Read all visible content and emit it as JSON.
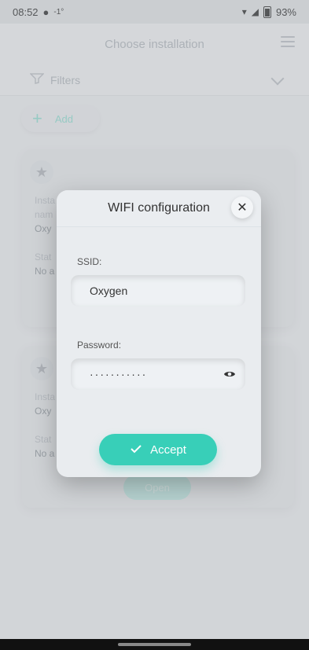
{
  "status_bar": {
    "time": "08:52",
    "temp": "-1°",
    "battery_pct": "93%"
  },
  "app": {
    "title": "Choose installation",
    "filters_label": "Filters",
    "add_label": "Add"
  },
  "cards": [
    {
      "installation_label_line1": "Insta",
      "installation_label_line2": "nam",
      "installation_value": "Oxy",
      "status_label": "Stat",
      "status_value": "No a"
    },
    {
      "installation_label_line1": "Insta",
      "installation_value": "Oxy",
      "status_label": "Stat",
      "status_value": "No a",
      "open_label": "Open"
    }
  ],
  "modal": {
    "title": "WIFI configuration",
    "ssid_label": "SSID:",
    "ssid_value": "Oxygen",
    "password_label": "Password:",
    "password_mask": "···········",
    "accept_label": "Accept"
  }
}
